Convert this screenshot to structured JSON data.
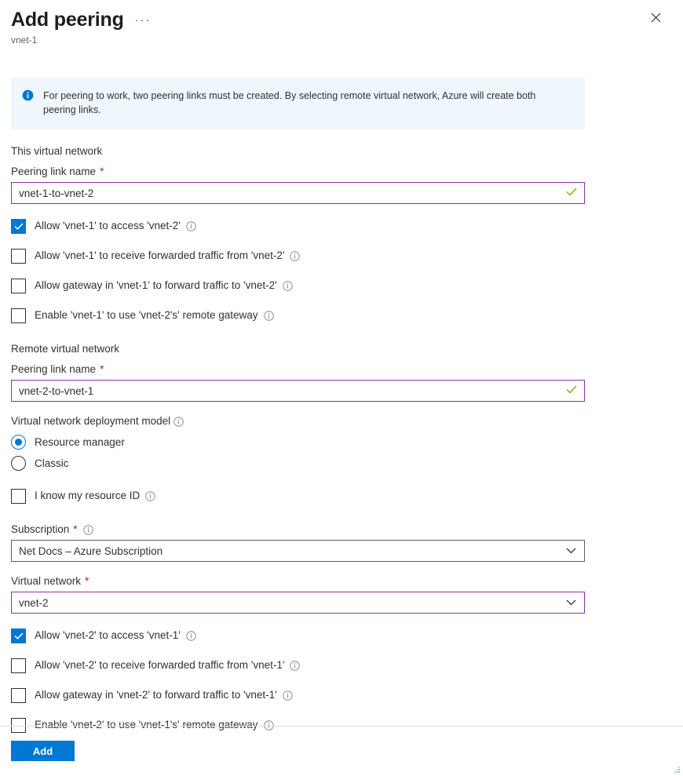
{
  "header": {
    "title": "Add peering",
    "subtitle": "vnet-1",
    "ellipsis_label": "···",
    "close_label": "Close"
  },
  "banner": {
    "icon": "info-circle-filled-icon",
    "text": "For peering to work, two peering links must be created. By selecting remote virtual network, Azure will create both peering links.",
    "background_color": "#eff6fc",
    "icon_color": "#0078d4"
  },
  "local_section": {
    "heading": "This virtual network",
    "peering_link_name": {
      "label": "Peering link name",
      "required_marker": "*",
      "value": "vnet-1-to-vnet-2",
      "placeholder": "",
      "valid": true,
      "border_color": "#8e2fa8",
      "check_color": "#6bb700"
    },
    "checkboxes": [
      {
        "label": "Allow 'vnet-1' to access 'vnet-2'",
        "checked": true,
        "info": true
      },
      {
        "label": "Allow 'vnet-1' to receive forwarded traffic from 'vnet-2'",
        "checked": false,
        "info": true
      },
      {
        "label": "Allow gateway in 'vnet-1' to forward traffic to 'vnet-2'",
        "checked": false,
        "info": true
      },
      {
        "label": "Enable 'vnet-1' to use 'vnet-2's' remote gateway",
        "checked": false,
        "info": true
      }
    ]
  },
  "remote_section": {
    "heading": "Remote virtual network",
    "peering_link_name": {
      "label": "Peering link name",
      "required_marker": "*",
      "value": "vnet-2-to-vnet-1",
      "placeholder": "",
      "valid": true,
      "border_color": "#8e2fa8",
      "check_color": "#6bb700"
    },
    "deployment_model": {
      "label": "Virtual network deployment model",
      "info": true,
      "options": [
        {
          "label": "Resource manager",
          "selected": true
        },
        {
          "label": "Classic",
          "selected": false
        }
      ]
    },
    "resource_id_checkbox": {
      "label": "I know my resource ID",
      "checked": false,
      "info": true
    },
    "subscription": {
      "label": "Subscription",
      "required_marker": "*",
      "info": true,
      "value": "Net Docs – Azure Subscription",
      "border_color": "#605e5c"
    },
    "virtual_network": {
      "label": "Virtual network",
      "required_marker": "*",
      "value": "vnet-2",
      "border_color": "#8e2fa8"
    },
    "checkboxes": [
      {
        "label": "Allow 'vnet-2' to access 'vnet-1'",
        "checked": true,
        "info": true
      },
      {
        "label": "Allow 'vnet-2' to receive forwarded traffic from 'vnet-1'",
        "checked": false,
        "info": true
      },
      {
        "label": "Allow gateway in 'vnet-2' to forward traffic to 'vnet-1'",
        "checked": false,
        "info": true
      },
      {
        "label": "Enable 'vnet-2' to use 'vnet-1's' remote gateway",
        "checked": false,
        "info": true
      }
    ]
  },
  "footer": {
    "add_label": "Add",
    "add_color": "#0078d4"
  }
}
